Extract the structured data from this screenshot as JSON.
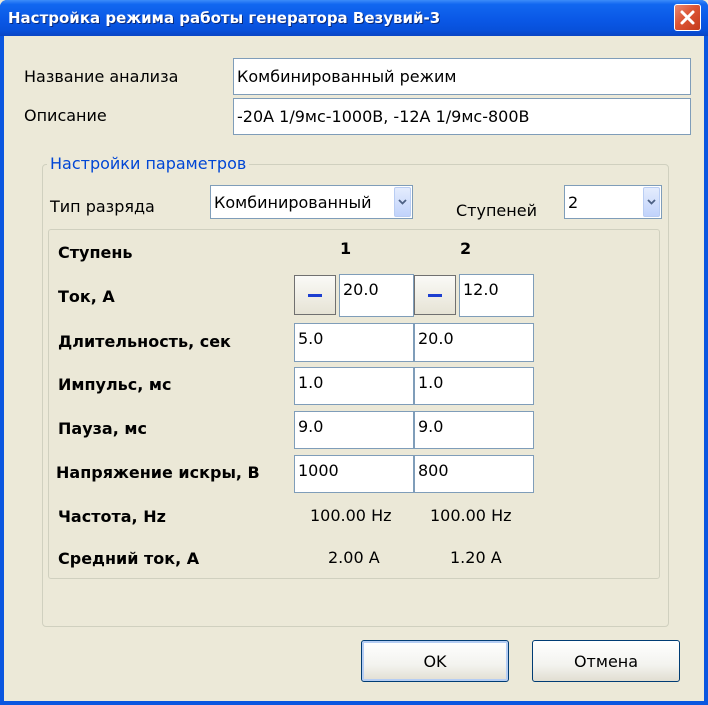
{
  "window": {
    "title": "Настройка режима работы генератора Везувий-3"
  },
  "analysis": {
    "name_label": "Название анализа",
    "name_value": "Комбинированный режим",
    "description_label": "Описание",
    "description_value": "-20А 1/9мс-1000В, -12А 1/9мс-800В"
  },
  "params": {
    "group_title": "Настройки параметров",
    "discharge_type_label": "Тип разряда",
    "discharge_type_value": "Комбинированный",
    "steps_label": "Ступеней",
    "steps_value": "2"
  },
  "table": {
    "step_label": "Ступень",
    "col1": "1",
    "col2": "2",
    "rows": {
      "current": {
        "label": "Ток, А",
        "v1": "20.0",
        "v2": "12.0"
      },
      "duration": {
        "label": "Длительность, сек",
        "v1": "5.0",
        "v2": "20.0"
      },
      "pulse": {
        "label": "Импульс, мс",
        "v1": "1.0",
        "v2": "1.0"
      },
      "pause": {
        "label": "Пауза, мс",
        "v1": "9.0",
        "v2": "9.0"
      },
      "voltage": {
        "label": "Напряжение искры, В",
        "v1": "1000",
        "v2": "800"
      },
      "frequency": {
        "label": "Частота, Hz",
        "v1": "100.00 Hz",
        "v2": "100.00 Hz"
      },
      "avg_current": {
        "label": "Средний ток, А",
        "v1": "2.00 A",
        "v2": "1.20 A"
      }
    }
  },
  "buttons": {
    "ok": "OK",
    "cancel": "Отмена"
  },
  "icons": {
    "close": "close-icon",
    "dropdown": "chevron-down-icon",
    "minus": "minus-icon"
  },
  "colors": {
    "titlebar": "#0a58e6",
    "dialog_bg": "#ece9d8",
    "group_title": "#0046d5",
    "close_button": "#dc5434"
  }
}
